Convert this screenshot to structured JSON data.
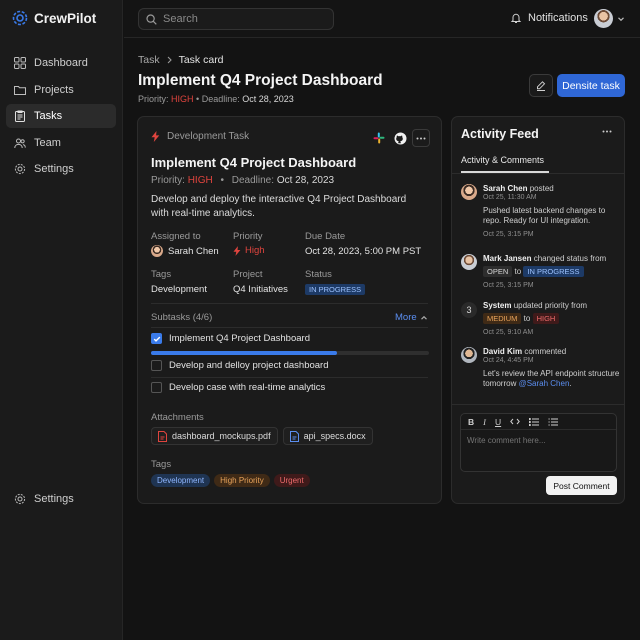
{
  "app": {
    "name": "CrewPilot"
  },
  "colors": {
    "accent": "#2f67d6",
    "danger": "#e0443e",
    "progress": "#3a7bea"
  },
  "sidebar": {
    "items": [
      {
        "label": "Dashboard",
        "icon": "grid-icon"
      },
      {
        "label": "Projects",
        "icon": "folder-icon"
      },
      {
        "label": "Tasks",
        "icon": "clipboard-icon",
        "active": true
      },
      {
        "label": "Team",
        "icon": "users-icon"
      },
      {
        "label": "Settings",
        "icon": "gear-icon"
      }
    ],
    "bottom": {
      "label": "Settings",
      "icon": "gear-icon"
    }
  },
  "topbar": {
    "search_placeholder": "Search",
    "notifications_label": "Notifications"
  },
  "header": {
    "breadcrumb": [
      "Task",
      "Task card"
    ],
    "title": "Implement Q4 Project Dashboard",
    "priority_label": "Priority:",
    "priority_value": "HIGH",
    "separator": "•",
    "deadline_label": "Deadline:",
    "deadline_value": "Oct 28, 2023",
    "primary_button": "Densite task"
  },
  "task": {
    "category": "Development Task",
    "title": "Implement Q4 Project Dashboard",
    "priority_label": "Priority:",
    "priority_value": "HIGH",
    "dot": "•",
    "deadline_label": "Deadline:",
    "deadline_value": "Oct 28, 2023",
    "description": "Develop and deploy the interactive Q4 Project Dashboard with real-time analytics.",
    "fields": {
      "assigned_label": "Assigned to",
      "assigned_value": "Sarah Chen",
      "priority_label": "Priority",
      "priority_value": "High",
      "due_label": "Due Date",
      "due_value": "Oct 28, 2023, 5:00 PM PST",
      "tags_label": "Tags",
      "tags_value": "Development",
      "project_label": "Project",
      "project_value": "Q4 Initiatives",
      "status_label": "Status",
      "status_value": "IN PROGRESS"
    },
    "subtasks": {
      "label": "Subtasks (4/6)",
      "more": "More",
      "progress": 0.67,
      "items": [
        {
          "label": "Implement Q4 Project Dashboard",
          "checked": true
        },
        {
          "label": "Develop and delloy project dashboard",
          "checked": false
        },
        {
          "label": "Develop case with real-time analytics",
          "checked": false
        }
      ]
    },
    "attachments": {
      "label": "Attachments",
      "files": [
        {
          "name": "dashboard_mockups.pdf",
          "icon": "pdf-file-icon"
        },
        {
          "name": "api_specs.docx",
          "icon": "doc-file-icon"
        }
      ]
    },
    "tags": {
      "label": "Tags",
      "items": [
        "Development",
        "High Priority",
        "Urgent"
      ]
    }
  },
  "activity": {
    "title": "Activity Feed",
    "tab": "Activity & Comments",
    "items": [
      {
        "name": "Sarah Chen",
        "action": "posted",
        "time": "Oct 25, 11:30 AM",
        "text": "Pushed latest backend changes to repo. Ready for UI integration.",
        "time2": "Oct 25, 3:15 PM"
      },
      {
        "name": "Mark Jansen",
        "action": "changed status from",
        "from": "OPEN",
        "to_word": "to",
        "to": "IN PROGRESS",
        "time": "Oct 25, 3:15 PM"
      },
      {
        "avatar_text": "3",
        "name": "System",
        "action": "updated priority from",
        "from": "MEDIUM",
        "to_word": "to",
        "to": "HIGH",
        "time": "Oct 25, 9:10 AM"
      },
      {
        "name": "David Kim",
        "action": "commented",
        "time": "Oct 24, 4:45 PM",
        "text": "Let's review the API endpoint structure tomorrow",
        "mention": "@Sarah Chen",
        "end": "."
      }
    ],
    "comment_placeholder": "Write comment here...",
    "post_button": "Post Comment"
  }
}
